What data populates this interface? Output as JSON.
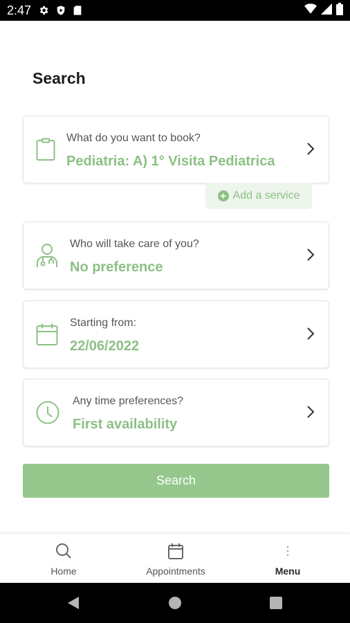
{
  "status_bar": {
    "time": "2:47",
    "icons": [
      "settings-icon",
      "play-protect-icon",
      "sd-card-icon",
      "wifi-icon",
      "signal-icon",
      "battery-icon"
    ]
  },
  "page": {
    "title": "Search"
  },
  "cards": [
    {
      "icon": "clipboard-icon",
      "label": "What do you want to book?",
      "value": "Pediatria: A) 1° Visita Pediatrica"
    },
    {
      "icon": "doctor-icon",
      "label": "Who will take care of you?",
      "value": "No preference"
    },
    {
      "icon": "calendar-icon",
      "label": "Starting from:",
      "value": "22/06/2022"
    },
    {
      "icon": "clock-icon",
      "label": "Any time preferences?",
      "value": "First availability"
    }
  ],
  "add_service": {
    "label": "Add a service"
  },
  "search_button": {
    "label": "Search"
  },
  "bottom_nav": {
    "items": [
      {
        "icon": "search-icon",
        "label": "Home"
      },
      {
        "icon": "calendar-icon",
        "label": "Appointments"
      },
      {
        "icon": "more-vertical-icon",
        "label": "Menu",
        "active": true
      }
    ]
  },
  "colors": {
    "accent": "#8cc084",
    "button": "#95c78c",
    "add_service_bg": "#eef5ec",
    "label_text": "#555555"
  }
}
